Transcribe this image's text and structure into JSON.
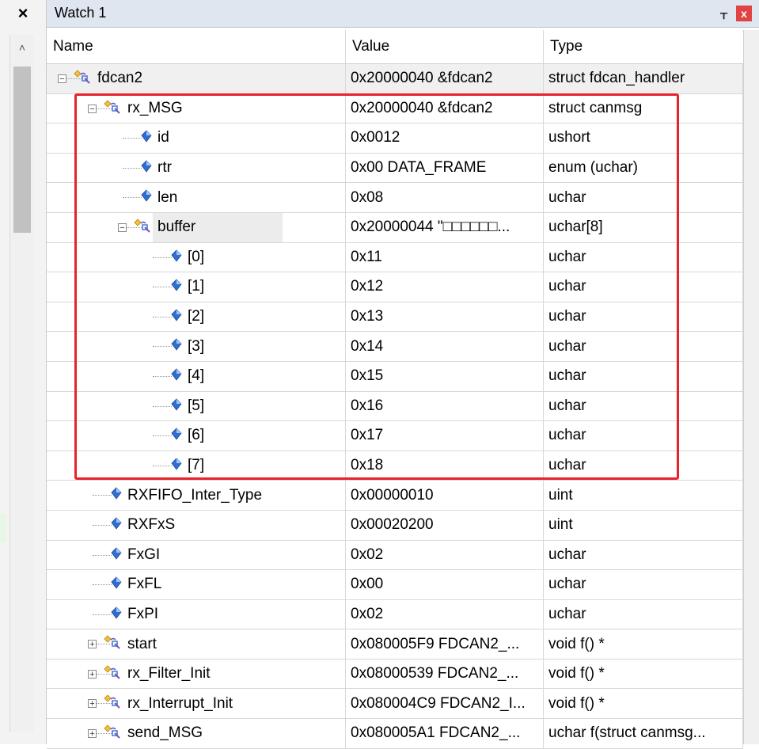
{
  "left_panel": {
    "close_glyph": "×",
    "scroll_up_glyph": "˄"
  },
  "window": {
    "title": "Watch 1",
    "pin_glyph": "ᚁ",
    "close_glyph": "x"
  },
  "columns": {
    "name": "Name",
    "value": "Value",
    "type": "Type"
  },
  "rows": [
    {
      "name": "fdcan2",
      "value": "0x20000040 &fdcan2",
      "type": "struct fdcan_handler"
    },
    {
      "name": "rx_MSG",
      "value": "0x20000040 &fdcan2",
      "type": "struct canmsg"
    },
    {
      "name": "id",
      "value": "0x0012",
      "type": "ushort"
    },
    {
      "name": "rtr",
      "value": "0x00 DATA_FRAME",
      "type": "enum (uchar)"
    },
    {
      "name": "len",
      "value": "0x08",
      "type": "uchar"
    },
    {
      "name": "buffer",
      "value": "0x20000044 \"□□□□□□...",
      "type": "uchar[8]"
    },
    {
      "name": "[0]",
      "value": "0x11",
      "type": "uchar"
    },
    {
      "name": "[1]",
      "value": "0x12",
      "type": "uchar"
    },
    {
      "name": "[2]",
      "value": "0x13",
      "type": "uchar"
    },
    {
      "name": "[3]",
      "value": "0x14",
      "type": "uchar"
    },
    {
      "name": "[4]",
      "value": "0x15",
      "type": "uchar"
    },
    {
      "name": "[5]",
      "value": "0x16",
      "type": "uchar"
    },
    {
      "name": "[6]",
      "value": "0x17",
      "type": "uchar"
    },
    {
      "name": "[7]",
      "value": "0x18",
      "type": "uchar"
    },
    {
      "name": "RXFIFO_Inter_Type",
      "value": "0x00000010",
      "type": "uint"
    },
    {
      "name": "RXFxS",
      "value": "0x00020200",
      "type": "uint"
    },
    {
      "name": "FxGI",
      "value": "0x02",
      "type": "uchar"
    },
    {
      "name": "FxFL",
      "value": "0x00",
      "type": "uchar"
    },
    {
      "name": "FxPI",
      "value": "0x02",
      "type": "uchar"
    },
    {
      "name": "start",
      "value": "0x080005F9 FDCAN2_...",
      "type": "void f()  *"
    },
    {
      "name": "rx_Filter_Init",
      "value": "0x08000539 FDCAN2_...",
      "type": "void f()  *"
    },
    {
      "name": "rx_Interrupt_Init",
      "value": "0x080004C9 FDCAN2_I...",
      "type": "void f()  *"
    },
    {
      "name": "send_MSG",
      "value": "0x080005A1 FDCAN2_...",
      "type": "uchar f(struct canmsg..."
    }
  ],
  "expander_glyphs": {
    "expanded": "−",
    "collapsed": "+"
  },
  "colors": {
    "highlight_border": "#e8222a",
    "titlebar_bg": "#dfe6f0",
    "close_button": "#e04343"
  }
}
